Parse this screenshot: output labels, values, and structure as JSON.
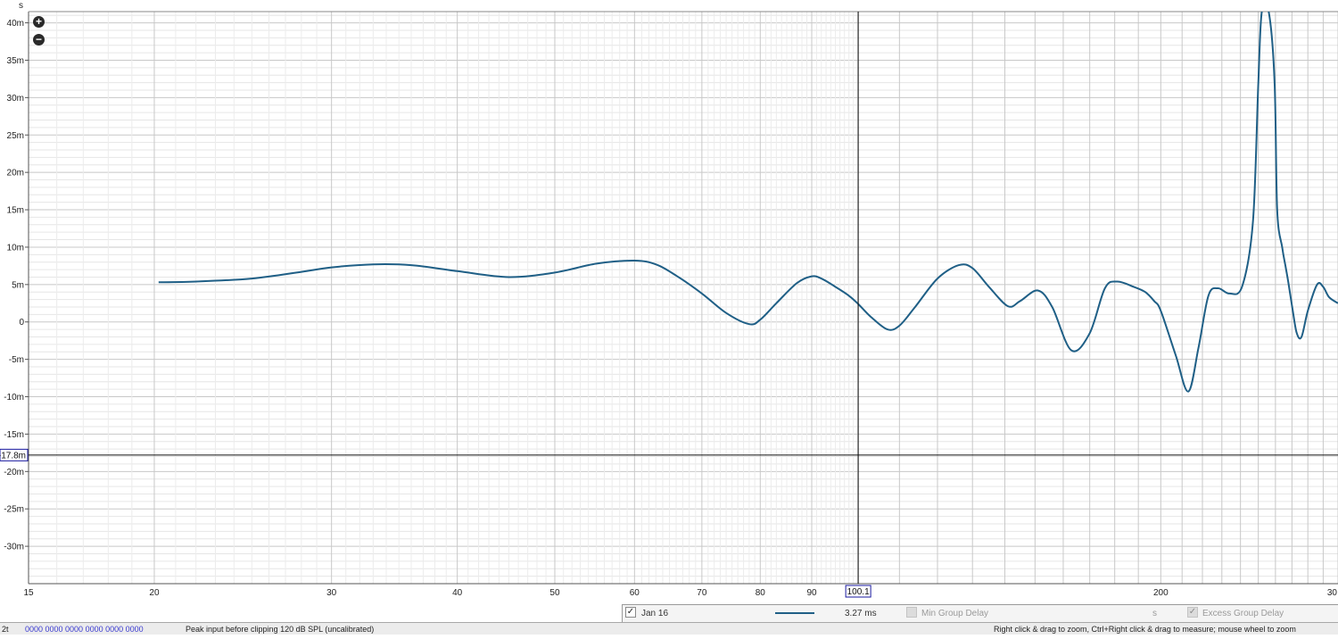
{
  "chart_data": {
    "type": "line",
    "y_unit": "s",
    "x_scale": "log",
    "xlim": [
      15,
      300
    ],
    "ylim": [
      -0.035,
      0.0415
    ],
    "y_ticks": [
      {
        "v": 0.04,
        "label": "40m"
      },
      {
        "v": 0.035,
        "label": "35m"
      },
      {
        "v": 0.03,
        "label": "30m"
      },
      {
        "v": 0.025,
        "label": "25m"
      },
      {
        "v": 0.02,
        "label": "20m"
      },
      {
        "v": 0.015,
        "label": "15m"
      },
      {
        "v": 0.01,
        "label": "10m"
      },
      {
        "v": 0.005,
        "label": "5m"
      },
      {
        "v": 0,
        "label": "0"
      },
      {
        "v": -0.005,
        "label": "-5m"
      },
      {
        "v": -0.01,
        "label": "-10m"
      },
      {
        "v": -0.015,
        "label": "-15m"
      },
      {
        "v": -0.02,
        "label": "-20m"
      },
      {
        "v": -0.025,
        "label": "-25m"
      },
      {
        "v": -0.03,
        "label": "-30m"
      }
    ],
    "x_ticks": [
      {
        "v": 15,
        "label": "15"
      },
      {
        "v": 20,
        "label": "20"
      },
      {
        "v": 30,
        "label": "30"
      },
      {
        "v": 40,
        "label": "40"
      },
      {
        "v": 50,
        "label": "50"
      },
      {
        "v": 60,
        "label": "60"
      },
      {
        "v": 70,
        "label": "70"
      },
      {
        "v": 80,
        "label": "80"
      },
      {
        "v": 90,
        "label": "90"
      },
      {
        "v": 200,
        "label": "200"
      },
      {
        "v": 300,
        "label": "30"
      }
    ],
    "grid": true,
    "cursor": {
      "x": 100.1,
      "x_label": "100.1",
      "y": -0.0178,
      "y_label": "-17.8m"
    },
    "series": [
      {
        "name": "Jan 16",
        "color": "#1f5f86",
        "x": [
          20.2,
          22,
          25,
          28,
          30,
          33,
          36,
          40,
          45,
          50,
          55,
          60,
          63,
          66,
          70,
          74,
          78,
          80,
          83,
          87,
          90,
          92,
          95,
          98,
          100.1,
          103,
          107,
          110,
          114,
          120,
          126,
          130,
          135,
          141,
          145,
          151,
          156,
          163,
          170,
          176,
          181,
          188,
          193,
          197,
          200,
          207,
          213,
          218,
          223,
          228,
          234,
          241,
          247,
          250,
          252,
          256,
          259.5,
          261,
          264,
          266,
          268,
          270.5,
          273,
          276,
          280,
          286,
          290,
          294,
          300
        ],
        "y": [
          0.0053,
          0.0054,
          0.0058,
          0.0067,
          0.0073,
          0.0077,
          0.0076,
          0.0068,
          0.006,
          0.0066,
          0.0078,
          0.0082,
          0.0077,
          0.0062,
          0.0038,
          0.0012,
          -0.0003,
          0.0003,
          0.0025,
          0.0052,
          0.0061,
          0.0058,
          0.0047,
          0.0035,
          0.0024,
          0.0007,
          -0.001,
          -0.0005,
          0.002,
          0.0058,
          0.0076,
          0.0072,
          0.0047,
          0.0021,
          0.0028,
          0.0042,
          0.002,
          -0.0038,
          -0.0015,
          0.0045,
          0.0054,
          0.0047,
          0.004,
          0.0028,
          0.0015,
          -0.0045,
          -0.0093,
          -0.0035,
          0.0035,
          0.0045,
          0.0038,
          0.0048,
          0.0135,
          0.032,
          0.0415,
          0.0415,
          0.032,
          0.015,
          0.01,
          0.0075,
          0.005,
          0.0015,
          -0.0015,
          -0.002,
          0.0015,
          0.005,
          0.0047,
          0.0033,
          0.0025
        ]
      }
    ]
  },
  "legend": {
    "series_checked_mark": "✓",
    "series_name": "Jan 16",
    "series_value": "3.27 ms",
    "min_group_delay_label": "Min Group Delay",
    "min_group_delay_unit": "s",
    "excess_checked_mark": "✓",
    "excess_group_delay_label": "Excess Group Delay"
  },
  "status_bar": {
    "left_fragment": "2t",
    "blue_text": "0000 0000   0000 0000   0000 0000",
    "message": "Peak input before clipping 120 dB SPL (uncalibrated)",
    "hint": "Right click & drag to zoom, Ctrl+Right click & drag to measure; mouse wheel to zoom"
  },
  "zoom": {
    "in_symbol": "+",
    "out_symbol": "−"
  }
}
